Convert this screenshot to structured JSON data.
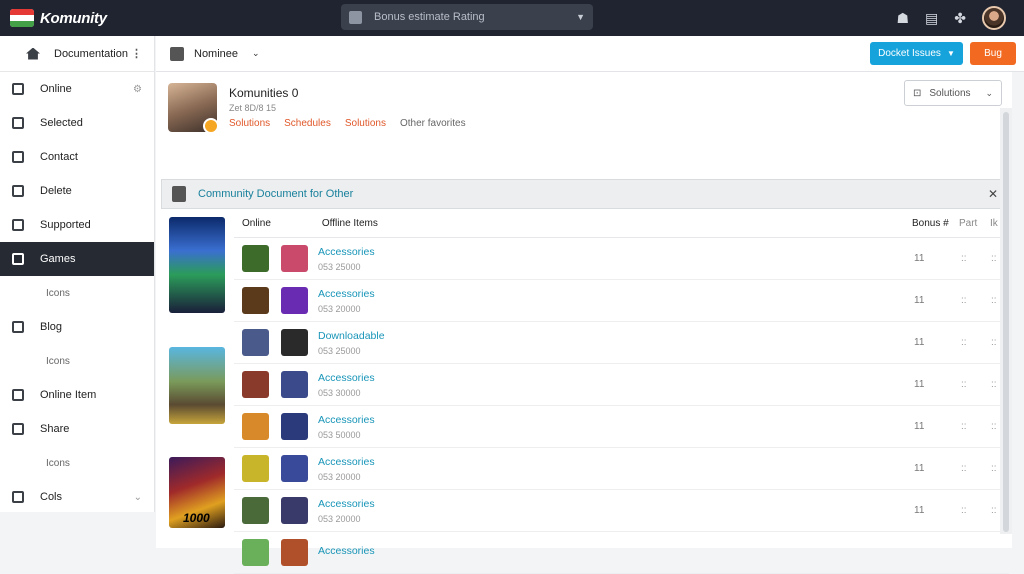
{
  "app": {
    "logo_text": "Komunity"
  },
  "search": {
    "placeholder": "Bonus estimate Rating"
  },
  "top_icons": [
    "people-icon",
    "document-icon",
    "puzzle-icon"
  ],
  "sidebar": {
    "header_label": "Documentation",
    "items": [
      {
        "label": "Online",
        "right": "⚙",
        "type": "item"
      },
      {
        "label": "Selected",
        "type": "item"
      },
      {
        "label": "Contact",
        "type": "item"
      },
      {
        "label": "Delete",
        "type": "item"
      },
      {
        "label": "Supported",
        "type": "item"
      },
      {
        "label": "Games",
        "type": "item",
        "active": true
      },
      {
        "label": "Icons",
        "type": "sub"
      },
      {
        "label": "Blog",
        "type": "item"
      },
      {
        "label": "Icons",
        "type": "sub"
      },
      {
        "label": "Online Item",
        "type": "item"
      },
      {
        "label": "Share",
        "type": "item"
      },
      {
        "label": "Icons",
        "type": "sub"
      },
      {
        "label": "Cols",
        "right": "⌄",
        "type": "item"
      }
    ]
  },
  "toolbar": {
    "label": "Nominee",
    "primary_button": "Docket Issues",
    "secondary_button": "Bug"
  },
  "profile": {
    "name": "Komunities 0",
    "sub": "Zet 8D/8 15",
    "tags": [
      "Solutions",
      "Schedules",
      "Solutions",
      "Other favorites"
    ],
    "select_label": "Solutions"
  },
  "notice": {
    "text": "Community Document for Other"
  },
  "table": {
    "headers": [
      "Online",
      "Offline Items",
      "Bonus #",
      "Part",
      "Ik"
    ],
    "rows": [
      {
        "title": "Accessories",
        "sub": "053 25000",
        "c1": "11",
        "c2": "::",
        "c3": "::"
      },
      {
        "title": "Accessories",
        "sub": "053 20000",
        "c1": "11",
        "c2": "::",
        "c3": "::"
      },
      {
        "title": "Downloadable",
        "sub": "053 25000",
        "c1": "11",
        "c2": "::",
        "c3": "::"
      },
      {
        "title": "Accessories",
        "sub": "053 30000",
        "c1": "11",
        "c2": "::",
        "c3": "::"
      },
      {
        "title": "Accessories",
        "sub": "053 50000",
        "c1": "11",
        "c2": "::",
        "c3": "::"
      },
      {
        "title": "Accessories",
        "sub": "053 20000",
        "c1": "11",
        "c2": "::",
        "c3": "::"
      },
      {
        "title": "Accessories",
        "sub": "053 20000",
        "c1": "11",
        "c2": "::",
        "c3": "::"
      },
      {
        "title": "Accessories",
        "sub": "",
        "c1": "",
        "c2": "",
        "c3": ""
      }
    ]
  },
  "game_banner_text": "1000"
}
